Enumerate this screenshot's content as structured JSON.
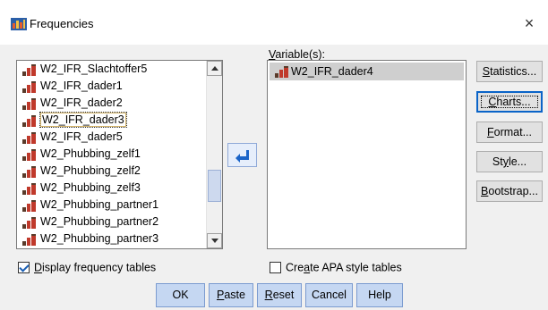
{
  "window": {
    "title": "Frequencies",
    "close_glyph": "×"
  },
  "source_list": {
    "items": [
      "W2_IFR_Slachtoffer5",
      "W2_IFR_dader1",
      "W2_IFR_dader2",
      "W2_IFR_dader3",
      "W2_IFR_dader5",
      "W2_Phubbing_zelf1",
      "W2_Phubbing_zelf2",
      "W2_Phubbing_zelf3",
      "W2_Phubbing_partner1",
      "W2_Phubbing_partner2",
      "W2_Phubbing_partner3"
    ],
    "focused_item": "W2_IFR_dader3",
    "scroll_position": 0.75
  },
  "move_button": {
    "icon": "arrow-left-icon"
  },
  "target": {
    "label": "Variable(s):",
    "items": [
      "W2_IFR_dader4"
    ]
  },
  "side_buttons": {
    "statistics": "Statistics...",
    "charts": "Charts...",
    "format": "Format...",
    "style": "Style...",
    "bootstrap": "Bootstrap..."
  },
  "checkboxes": {
    "display_frequency_tables": {
      "label": "Display frequency tables",
      "checked": true
    },
    "apa_style_tables": {
      "label": "Create APA style tables",
      "checked": false
    }
  },
  "footer_buttons": {
    "ok": "OK",
    "paste": "Paste",
    "reset": "Reset",
    "cancel": "Cancel",
    "help": "Help"
  },
  "colors": {
    "dialog_bg": "#f0f0f0",
    "selected_item_bg": "#cfcfcf",
    "footer_button_bg": "#c5d7f2",
    "focus_border": "#0a64c8",
    "ruler_icon_red": "#c0392b",
    "ruler_icon_dark": "#5a3b2a"
  }
}
